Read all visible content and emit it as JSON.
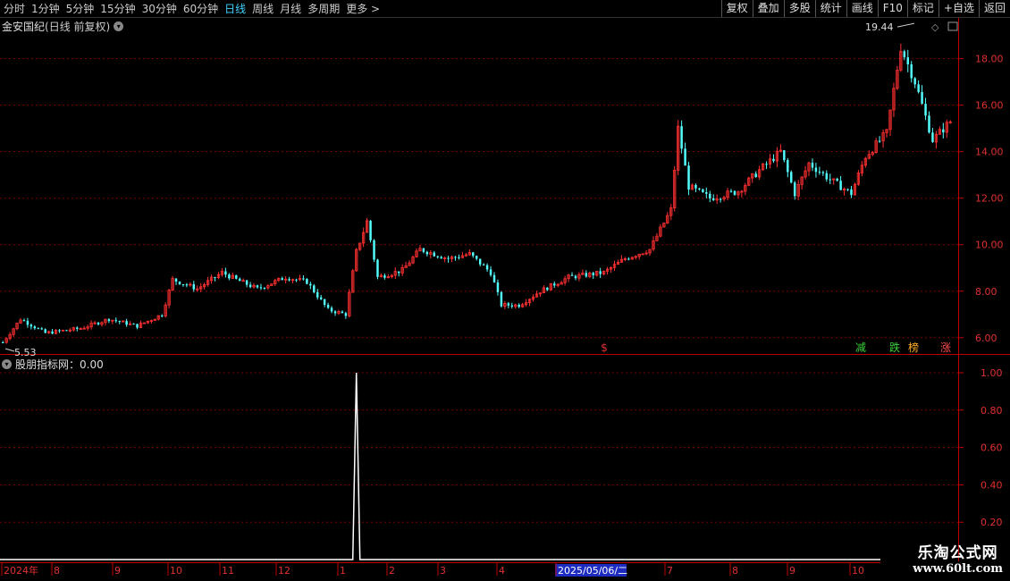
{
  "toolbar": {
    "periods": [
      "分时",
      "1分钟",
      "5分钟",
      "15分钟",
      "30分钟",
      "60分钟",
      "日线",
      "周线",
      "月线",
      "多周期",
      "更多"
    ],
    "active_period": "日线",
    "more_arrow": ">",
    "actions": [
      "复权",
      "叠加",
      "多股",
      "统计",
      "画线",
      "F10",
      "标记",
      "+自选",
      "返回"
    ]
  },
  "main_chart": {
    "stock_name": "金安国纪",
    "mode_label": "(日线 前复权)",
    "high_label": "19.44",
    "low_label": "5.53",
    "y_ticks": [
      "18.00",
      "16.00",
      "14.00",
      "12.00",
      "10.00",
      "8.00",
      "6.00"
    ],
    "signals": [
      {
        "text": "$",
        "color": "#e03030"
      },
      {
        "text": "减",
        "color": "#3ad13a"
      },
      {
        "text": "跌",
        "color": "#3ad13a"
      },
      {
        "text": "榜",
        "color": "#ffaa22"
      },
      {
        "text": "涨",
        "color": "#ff4a4a"
      }
    ]
  },
  "indicator": {
    "title": "股朋指标网：0.00",
    "y_ticks": [
      "1.00",
      "0.80",
      "0.60",
      "0.40",
      "0.20"
    ]
  },
  "x_axis": {
    "labels": [
      "2024年",
      "8",
      "9",
      "10",
      "11",
      "12",
      "1",
      "2",
      "3",
      "4",
      "2025/05/06/二",
      "7",
      "8",
      "9",
      "10"
    ]
  },
  "watermark": {
    "line1": "乐淘公式网",
    "line2": "www.60lt.com"
  },
  "colors": {
    "up": "#ff3030",
    "down": "#54ffff",
    "grid": "#7a0000",
    "axis": "#c00000",
    "active": "#3fd3ff",
    "date_highlight_bg": "#1d2bc0"
  },
  "chart_data": {
    "type": "candlestick",
    "price_range": [
      5.3,
      19.6
    ],
    "indicator_range": [
      0,
      1.0
    ],
    "key_points": [
      {
        "label": "low",
        "value": 5.53
      },
      {
        "label": "high",
        "value": 19.44
      }
    ],
    "spike_index": 100,
    "spike_value": 1.0
  }
}
